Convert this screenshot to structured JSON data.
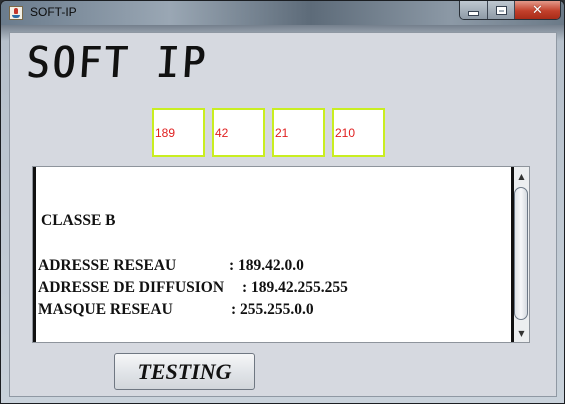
{
  "window": {
    "title": "SOFT-IP",
    "controls": {
      "minimize_icon": "minimize-icon",
      "maximize_icon": "maximize-icon",
      "close_icon": "close-icon",
      "close_glyph": "✕"
    }
  },
  "logo": {
    "text": "SOFT IP"
  },
  "ip_octets": [
    "189",
    "42",
    "21",
    "210"
  ],
  "result": {
    "class_line": "CLASSE B",
    "rows": [
      {
        "label": "ADRESSE RESEAU",
        "value": ": 189.42.0.0"
      },
      {
        "label": "ADRESSE DE DIFFUSION",
        "value": ": 189.42.255.255"
      },
      {
        "label": "MASQUE RESEAU",
        "value": ": 255.255.0.0"
      }
    ]
  },
  "scrollbar": {
    "up_glyph": "▲",
    "down_glyph": "▼"
  },
  "buttons": {
    "testing": "TESTING"
  },
  "colors": {
    "octet_border": "#c9ee21",
    "octet_text": "#e02020",
    "client_background": "#d6d9e0",
    "close_button": "#c2402b"
  }
}
